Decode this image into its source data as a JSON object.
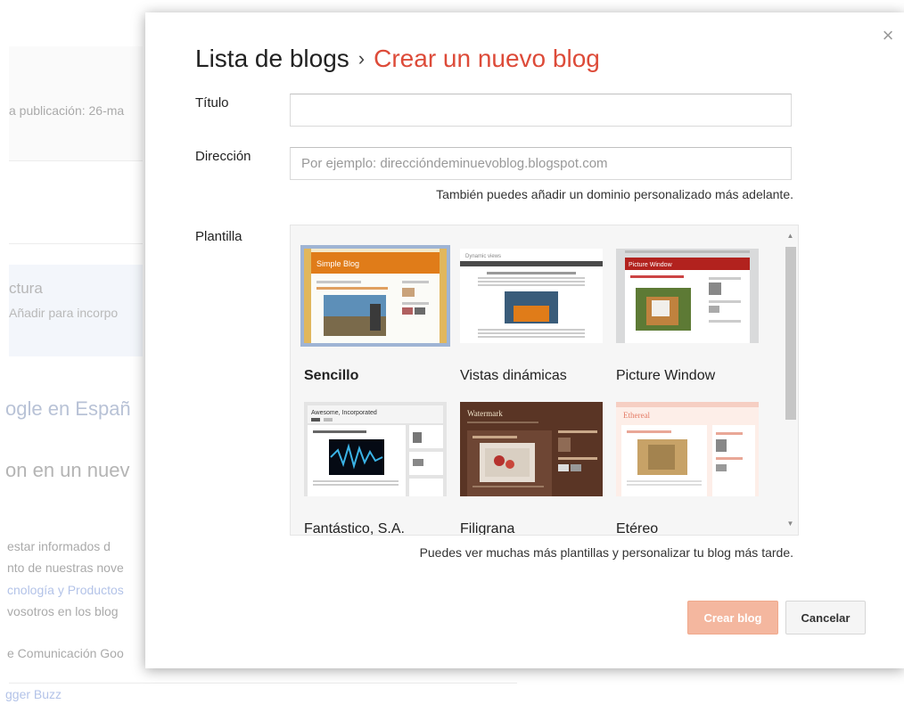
{
  "background": {
    "publication_text": "a publicación: 26-ma",
    "reading_title": "ctura",
    "reading_desc": "Añadir para incorpo",
    "google_spain": "ogle en Españ",
    "new_heading": "on en un nuev",
    "para1_line1": "estar informados d",
    "para1_line2": "nto de nuestras nove",
    "para1_line3": "cnología y Productos",
    "para1_line4": "vosotros en los blog",
    "comms": "e Comunicación Goo",
    "buzz": "gger Buzz"
  },
  "dialog": {
    "breadcrumb_list": "Lista de blogs",
    "breadcrumb_sep": "›",
    "breadcrumb_current": "Crear un nuevo blog",
    "close_symbol": "×",
    "title_label": "Título",
    "title_value": "",
    "address_label": "Dirección",
    "address_placeholder": "Por ejemplo: direccióndeminuevoblog.blogspot.com",
    "address_hint": "También puedes añadir un dominio personalizado más adelante.",
    "template_label": "Plantilla",
    "templates": [
      {
        "name": "Sencillo",
        "selected": true,
        "thumb_text": "Simple Blog"
      },
      {
        "name": "Vistas dinámicas",
        "selected": false,
        "thumb_text": "Dynamic views"
      },
      {
        "name": "Picture Window",
        "selected": false,
        "thumb_text": "Picture Window"
      },
      {
        "name": "Fantástico, S.A.",
        "selected": false,
        "thumb_text": "Awesome, Incorporated"
      },
      {
        "name": "Filigrana",
        "selected": false,
        "thumb_text": "Watermark"
      },
      {
        "name": "Etéreo",
        "selected": false,
        "thumb_text": "Ethereal"
      }
    ],
    "template_hint": "Puedes ver muchas más plantillas y personalizar tu blog más tarde.",
    "create_button": "Crear blog",
    "cancel_button": "Cancelar"
  },
  "colors": {
    "accent": "#dd4b39",
    "create_button_bg": "#f4b79f",
    "selected_border": "#9fb4d4"
  }
}
